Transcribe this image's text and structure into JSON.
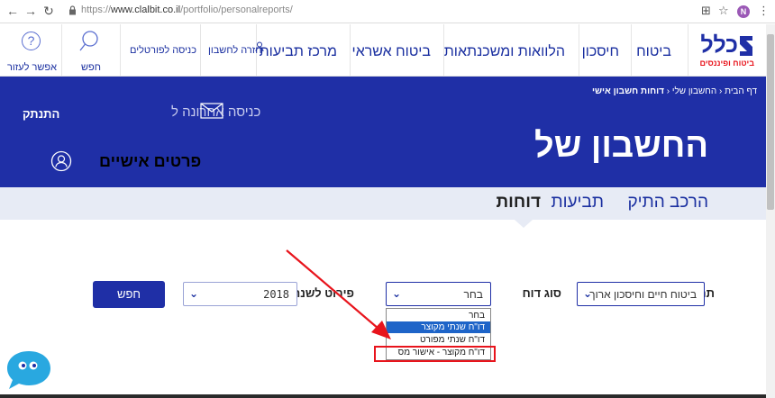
{
  "browser": {
    "url_scheme": "https://",
    "url_host": "www.clalbit.co.il",
    "url_path": "/portfolio/personalreports/",
    "avatar_letter": "N"
  },
  "nav": {
    "logo_main": "כלל",
    "logo_sub": "ביטוח ופיננסים",
    "items": [
      "ביטוח",
      "חיסכון",
      "הלוואות ומשכנתאות",
      "ביטוח אשראי",
      "מרכז תביעות"
    ],
    "util_login": "כניסה לפורטלים",
    "util_account_return": "חזרה לחשבון",
    "search": "חפש",
    "help": "אפשר לעזור",
    "help_glyph": "?"
  },
  "hero": {
    "breadcrumb_home": "דף הבית",
    "breadcrumb_account": "החשבון שלי",
    "breadcrumb_current": "דוחות חשבון אישי",
    "title": "החשבון של",
    "logout": "התנתק",
    "last_login": "כניסה אחרונה ל",
    "personal_details": "פרטים אישיים"
  },
  "tabs": [
    "הרכב התיק",
    "תביעות",
    "דוחות"
  ],
  "form": {
    "field_area_label": "תחום",
    "field_area_value": "ביטוח חיים וחיסכון ארוך",
    "report_type_label": "סוג דוח",
    "report_type_value": "בחר",
    "year_label": "פירוט לשנת",
    "year_value": "2018",
    "search_button": "חפש",
    "report_options": [
      "בחר",
      "דו\"ח שנתי מקוצר",
      "דו\"ח שנתי מפורט",
      "דו\"ח מקוצר - אישור מס"
    ]
  },
  "colors": {
    "brand_blue": "#1f2fa6",
    "highlight_red": "#e8141c",
    "selected_option": "#1e64c8"
  }
}
